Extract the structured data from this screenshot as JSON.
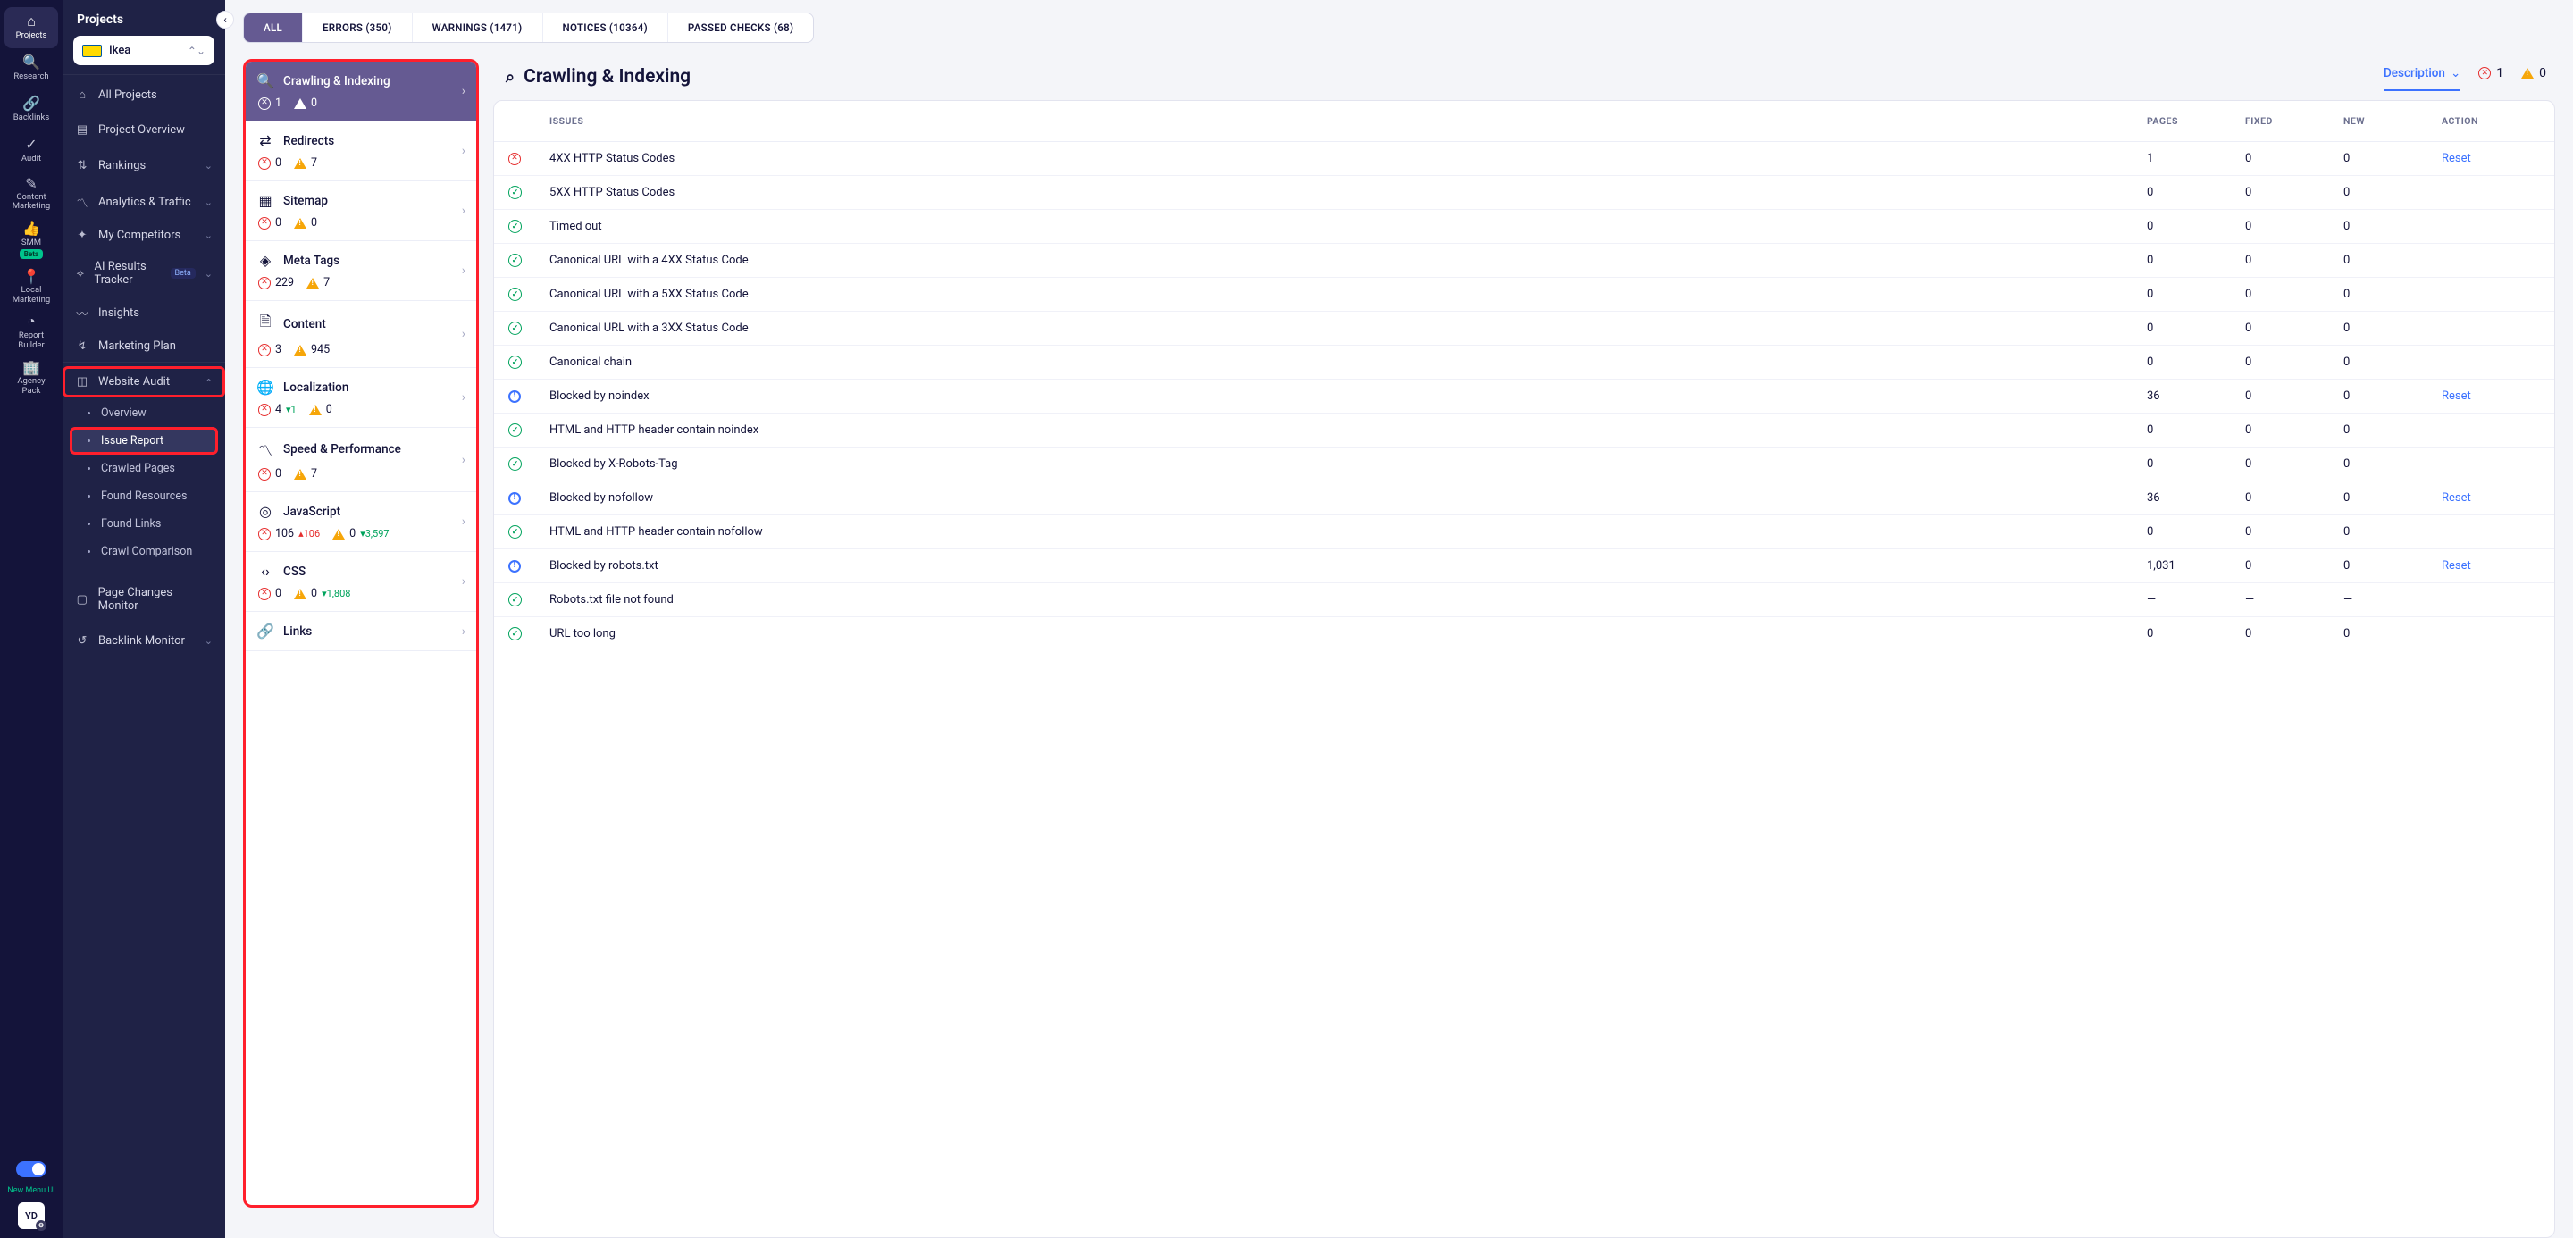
{
  "rail": {
    "items": [
      {
        "key": "projects",
        "label": "Projects",
        "icon": "⌂",
        "active": true
      },
      {
        "key": "research",
        "label": "Research",
        "icon": "🔍"
      },
      {
        "key": "backlinks",
        "label": "Backlinks",
        "icon": "🔗"
      },
      {
        "key": "audit",
        "label": "Audit",
        "icon": "✓"
      },
      {
        "key": "content",
        "label": "Content\nMarketing",
        "icon": "✎"
      },
      {
        "key": "smm",
        "label": "SMM",
        "icon": "👍",
        "beta": true
      },
      {
        "key": "local",
        "label": "Local\nMarketing",
        "icon": "📍"
      },
      {
        "key": "report",
        "label": "Report\nBuilder",
        "icon": "◔"
      },
      {
        "key": "agency",
        "label": "Agency\nPack",
        "icon": "🏢"
      }
    ],
    "new_menu_label": "New Menu UI",
    "avatar": "YD"
  },
  "sidebar": {
    "title": "Projects",
    "project": "Ikea",
    "items": [
      {
        "label": "All Projects",
        "icon": "⌂"
      },
      {
        "label": "Project Overview",
        "icon": "▤"
      },
      {
        "label": "Rankings",
        "icon": "⇅",
        "chev": true
      },
      {
        "label": "Analytics & Traffic",
        "icon": "〽",
        "chev": true
      },
      {
        "label": "My Competitors",
        "icon": "✦",
        "chev": true
      },
      {
        "label": "AI Results Tracker",
        "icon": "⟡",
        "chev": true,
        "beta": true
      },
      {
        "label": "Insights",
        "icon": "〰"
      },
      {
        "label": "Marketing Plan",
        "icon": "↯"
      },
      {
        "label": "Website Audit",
        "icon": "◫",
        "chev": true,
        "highlighted": true,
        "expanded": true
      },
      {
        "label": "Page Changes Monitor",
        "icon": "▢"
      },
      {
        "label": "Backlink Monitor",
        "icon": "↺",
        "chev": true
      }
    ],
    "audit_sub": [
      {
        "label": "Overview"
      },
      {
        "label": "Issue Report",
        "active": true,
        "hl": true
      },
      {
        "label": "Crawled Pages"
      },
      {
        "label": "Found Resources"
      },
      {
        "label": "Found Links"
      },
      {
        "label": "Crawl Comparison"
      }
    ]
  },
  "tabs": [
    {
      "label": "ALL",
      "active": true
    },
    {
      "label": "ERRORS (350)"
    },
    {
      "label": "WARNINGS (1471)"
    },
    {
      "label": "NOTICES (10364)"
    },
    {
      "label": "PASSED CHECKS (68)"
    }
  ],
  "categories": [
    {
      "title": "Crawling & Indexing",
      "icon": "🔍",
      "active": true,
      "err": "1",
      "warn": "0"
    },
    {
      "title": "Redirects",
      "icon": "⇄",
      "err": "0",
      "warn": "7"
    },
    {
      "title": "Sitemap",
      "icon": "▦",
      "err": "0",
      "warn": "0"
    },
    {
      "title": "Meta Tags",
      "icon": "◈",
      "err": "229",
      "warn": "7"
    },
    {
      "title": "Content",
      "icon": "🗎",
      "err": "3",
      "warn": "945"
    },
    {
      "title": "Localization",
      "icon": "🌐",
      "err": "4",
      "err_delta": "▾1",
      "warn": "0"
    },
    {
      "title": "Speed & Performance",
      "icon": "〽",
      "err": "0",
      "warn": "7"
    },
    {
      "title": "JavaScript",
      "icon": "◎",
      "err": "106",
      "err_delta": "▴106",
      "warn": "0",
      "warn_delta": "▾3,597"
    },
    {
      "title": "CSS",
      "icon": "‹›",
      "err": "0",
      "warn": "0",
      "warn_delta": "▾1,808"
    },
    {
      "title": "Links",
      "icon": "🔗",
      "partial": true
    }
  ],
  "detail": {
    "title": "Crawling & Indexing",
    "mode_label": "Description",
    "err_count": "1",
    "warn_count": "0",
    "columns": {
      "issues": "ISSUES",
      "pages": "PAGES",
      "fixed": "FIXED",
      "new": "NEW",
      "action": "ACTION"
    },
    "rows": [
      {
        "status": "err",
        "name": "4XX HTTP Status Codes",
        "pages": "1",
        "fixed": "0",
        "new": "0",
        "action": "Reset"
      },
      {
        "status": "ok",
        "name": "5XX HTTP Status Codes",
        "pages": "0",
        "fixed": "0",
        "new": "0"
      },
      {
        "status": "ok",
        "name": "Timed out",
        "pages": "0",
        "fixed": "0",
        "new": "0"
      },
      {
        "status": "ok",
        "name": "Canonical URL with a 4XX Status Code",
        "pages": "0",
        "fixed": "0",
        "new": "0"
      },
      {
        "status": "ok",
        "name": "Canonical URL with a 5XX Status Code",
        "pages": "0",
        "fixed": "0",
        "new": "0"
      },
      {
        "status": "ok",
        "name": "Canonical URL with a 3XX Status Code",
        "pages": "0",
        "fixed": "0",
        "new": "0"
      },
      {
        "status": "ok",
        "name": "Canonical chain",
        "pages": "0",
        "fixed": "0",
        "new": "0"
      },
      {
        "status": "info",
        "name": "Blocked by noindex",
        "pages": "36",
        "fixed": "0",
        "new": "0",
        "action": "Reset"
      },
      {
        "status": "ok",
        "name": "HTML and HTTP header contain noindex",
        "pages": "0",
        "fixed": "0",
        "new": "0"
      },
      {
        "status": "ok",
        "name": "Blocked by X-Robots-Tag",
        "pages": "0",
        "fixed": "0",
        "new": "0"
      },
      {
        "status": "info",
        "name": "Blocked by nofollow",
        "pages": "36",
        "fixed": "0",
        "new": "0",
        "action": "Reset"
      },
      {
        "status": "ok",
        "name": "HTML and HTTP header contain nofollow",
        "pages": "0",
        "fixed": "0",
        "new": "0"
      },
      {
        "status": "info",
        "name": "Blocked by robots.txt",
        "pages": "1,031",
        "fixed": "0",
        "new": "0",
        "action": "Reset"
      },
      {
        "status": "ok",
        "name": "Robots.txt file not found",
        "pages": "—",
        "fixed": "—",
        "new": "—"
      },
      {
        "status": "ok",
        "name": "URL too long",
        "pages": "0",
        "fixed": "0",
        "new": "0"
      }
    ]
  }
}
